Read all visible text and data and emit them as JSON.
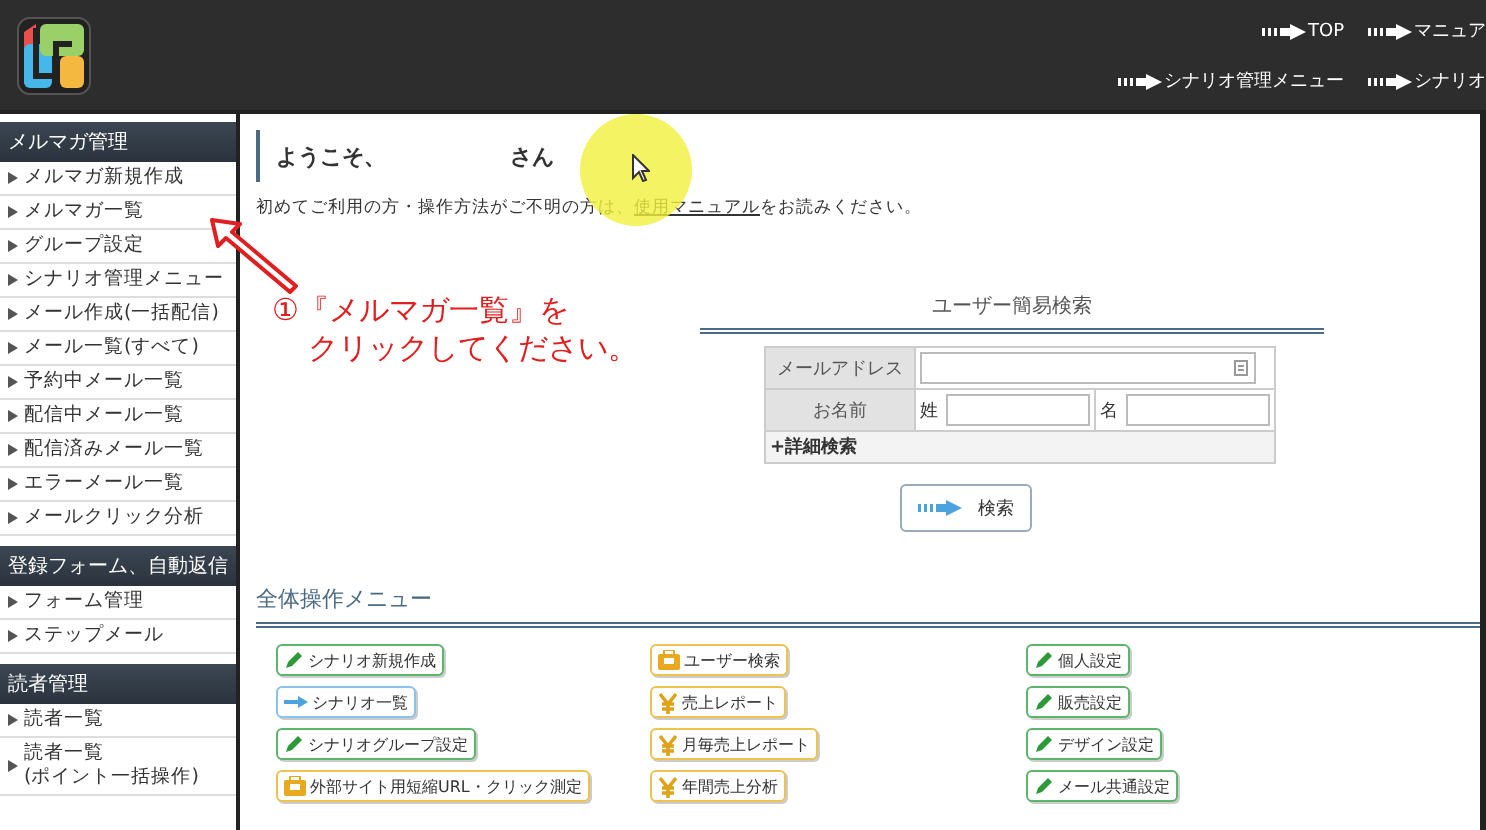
{
  "header": {
    "top_links": [
      "TOP",
      "マニュア"
    ],
    "sub_links": [
      "シナリオ管理メニュー",
      "シナリオ"
    ]
  },
  "sidebar": {
    "sections": [
      {
        "title": "メルマガ管理",
        "items": [
          "メルマガ新規作成",
          "メルマガ一覧",
          "グループ設定",
          "シナリオ管理メニュー",
          "メール作成(一括配信)",
          "メール一覧(すべて)",
          "予約中メール一覧",
          "配信中メール一覧",
          "配信済みメール一覧",
          "エラーメール一覧",
          "メールクリック分析"
        ]
      },
      {
        "title": "登録フォーム、自動返信",
        "items": [
          "フォーム管理",
          "ステップメール"
        ]
      },
      {
        "title": "読者管理",
        "items": [
          "読者一覧",
          "読者一覧\n(ポイント一括操作)"
        ]
      }
    ]
  },
  "welcome": {
    "greeting": "ようこそ、",
    "suffix": "さん"
  },
  "intro": {
    "before": "初めてご利用の方・操作方法がご不明の方は、",
    "link": "使用マニュアル",
    "after": "をお読みください。"
  },
  "annotation": {
    "lines": [
      "①『メルマガ一覧』を",
      "クリックしてください。"
    ]
  },
  "search": {
    "title": "ユーザー簡易検索",
    "email_label": "メールアドレス",
    "name_label": "お名前",
    "last_name_label": "姓",
    "first_name_label": "名",
    "advanced": "+詳細検索",
    "button": "検索"
  },
  "menu": {
    "title": "全体操作メニュー",
    "items": [
      {
        "label": "シナリオ新規作成",
        "kind": "pencil"
      },
      {
        "label": "ユーザー検索",
        "kind": "bag"
      },
      {
        "label": "個人設定",
        "kind": "pencil"
      },
      {
        "label": "シナリオ一覧",
        "kind": "arrow"
      },
      {
        "label": "売上レポート",
        "kind": "yen"
      },
      {
        "label": "販売設定",
        "kind": "pencil"
      },
      {
        "label": "シナリオグループ設定",
        "kind": "pencil"
      },
      {
        "label": "月毎売上レポート",
        "kind": "yen"
      },
      {
        "label": "デザイン設定",
        "kind": "pencil"
      },
      {
        "label": "外部サイト用短縮URL・クリック測定",
        "kind": "bag"
      },
      {
        "label": "年間売上分析",
        "kind": "yen"
      },
      {
        "label": "メール共通設定",
        "kind": "pencil"
      }
    ]
  }
}
